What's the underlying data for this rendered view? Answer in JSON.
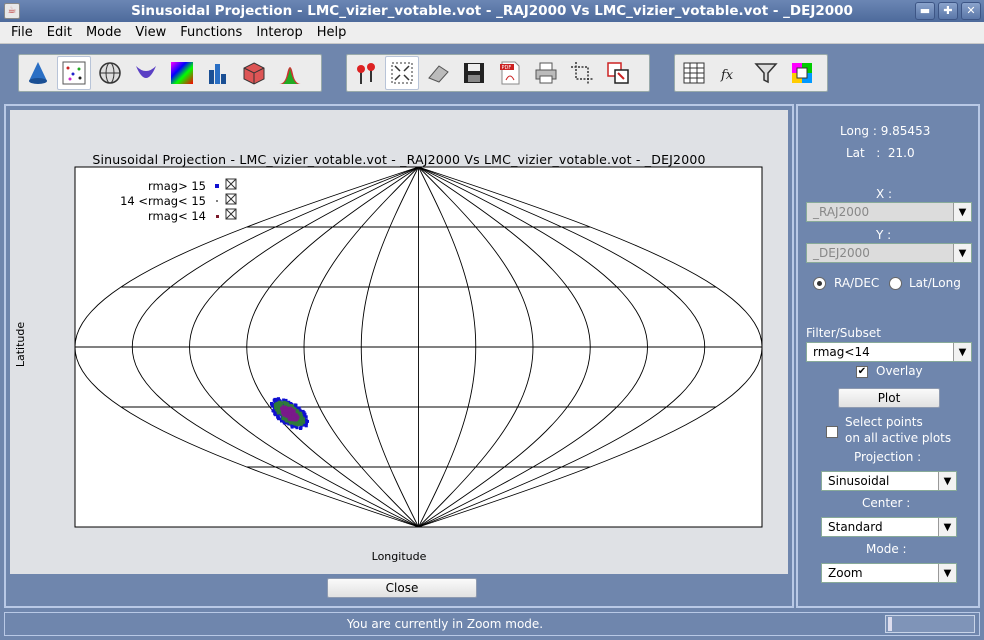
{
  "window": {
    "title": "Sinusoidal Projection - LMC_vizier_votable.vot - _RAJ2000   Vs  LMC_vizier_votable.vot - _DEJ2000"
  },
  "menu": [
    "File",
    "Edit",
    "Mode",
    "View",
    "Functions",
    "Interop",
    "Help"
  ],
  "toolbar": {
    "group1": [
      "cone-icon",
      "scatter-plot-icon",
      "globe-icon",
      "surface-icon",
      "density-map-icon",
      "histogram-icon",
      "cube-icon",
      "distribution-icon"
    ],
    "group2": [
      "pin-icon",
      "fit-to-window-icon",
      "eraser-icon",
      "save-icon",
      "pdf-icon",
      "print-icon",
      "crop-icon",
      "export-icon"
    ],
    "group3": [
      "table-icon",
      "function-fx-icon",
      "filter-icon",
      "colorize-icon"
    ]
  },
  "plot": {
    "title": "Sinusoidal Projection - LMC_vizier_votable.vot - _RAJ2000   Vs  LMC_vizier_votable.vot - _DEJ2000",
    "xlabel": "Longitude",
    "ylabel": "Latitude",
    "legend": [
      {
        "label": "rmag> 15",
        "color": "#1010d0"
      },
      {
        "label": "14 <rmag< 15",
        "color": "#808080"
      },
      {
        "label": "rmag< 14",
        "color": "#7a1a2a"
      }
    ]
  },
  "close_label": "Close",
  "side": {
    "long": "Long : 9.85453",
    "lat": "Lat   :  21.0",
    "x_label": "X :",
    "x_value": "_RAJ2000",
    "y_label": "Y :",
    "y_value": "_DEJ2000",
    "radio_radec": "RA/DEC",
    "radio_latlong": "Lat/Long",
    "filter_label": "Filter/Subset",
    "filter_value": "rmag<14",
    "overlay_label": "Overlay",
    "plot_label": "Plot",
    "select_line1": "Select points",
    "select_line2": "on all active plots",
    "projection_label": "Projection :",
    "projection_value": "Sinusoidal",
    "center_label": "Center :",
    "center_value": "Standard",
    "mode_label": "Mode :",
    "mode_value": "Zoom"
  },
  "status": "You are currently in Zoom mode."
}
